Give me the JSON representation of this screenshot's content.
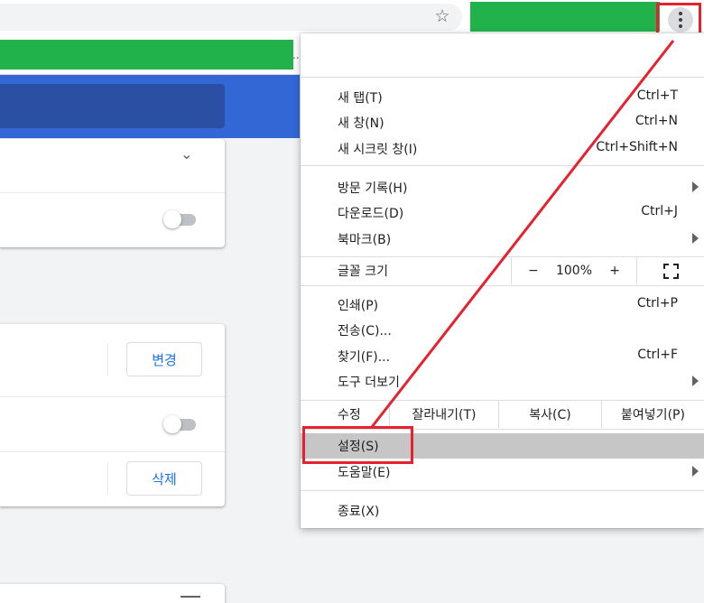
{
  "toolbar": {
    "bookmark_icon": "star-icon",
    "menu_icon": "vertical-ellipsis-icon",
    "ellipsis": ".."
  },
  "settings_page": {
    "change_button": "변경",
    "delete_button": "삭제",
    "dropdown_icon": "chevron-down-icon"
  },
  "menu": {
    "group1": [
      {
        "label": "새 탭(T)",
        "shortcut": "Ctrl+T"
      },
      {
        "label": "새 창(N)",
        "shortcut": "Ctrl+N"
      },
      {
        "label": "새 시크릿 창(I)",
        "shortcut": "Ctrl+Shift+N"
      }
    ],
    "group2": [
      {
        "label": "방문 기록(H)",
        "shortcut": ""
      },
      {
        "label": "다운로드(D)",
        "shortcut": "Ctrl+J"
      },
      {
        "label": "북마크(B)",
        "shortcut": ""
      }
    ],
    "zoom": {
      "label": "글꼴 크기",
      "minus": "−",
      "value": "100%",
      "plus": "+",
      "fullscreen_icon": "fullscreen-icon"
    },
    "group3": [
      {
        "label": "인쇄(P)",
        "shortcut": "Ctrl+P"
      },
      {
        "label": "전송(C)...",
        "shortcut": ""
      },
      {
        "label": "찾기(F)...",
        "shortcut": "Ctrl+F"
      },
      {
        "label": "도구 더보기",
        "shortcut": ""
      }
    ],
    "edit": {
      "label": "수정",
      "cut": "잘라내기(T)",
      "copy": "복사(C)",
      "paste": "붙여넣기(P)"
    },
    "settings": {
      "label": "설정(S)"
    },
    "help": {
      "label": "도움말(E)"
    },
    "exit": {
      "label": "종료(X)"
    }
  },
  "colors": {
    "highlight_red": "#e8212e",
    "green": "#21b24b",
    "blue_header": "#3367d6"
  }
}
